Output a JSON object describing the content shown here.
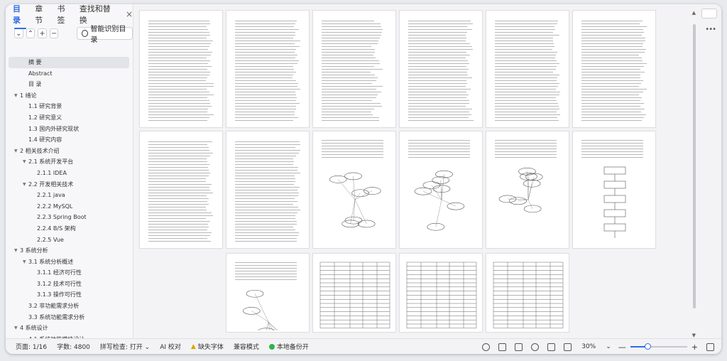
{
  "sidebar": {
    "tabs": [
      {
        "label": "目录",
        "active": true
      },
      {
        "label": "章节",
        "active": false
      },
      {
        "label": "书签",
        "active": false
      },
      {
        "label": "查找和替换",
        "active": false
      }
    ],
    "close_glyph": "×",
    "tools": {
      "collapse_glyph": "⌄",
      "expand_glyph": "⌃",
      "add_glyph": "+",
      "remove_glyph": "−",
      "ai_toc_label": "智能识别目录"
    },
    "toc": [
      {
        "label": "摘  要",
        "level": 1,
        "caret": "",
        "selected": true
      },
      {
        "label": "Abstract",
        "level": 1,
        "caret": ""
      },
      {
        "label": "目  录",
        "level": 1,
        "caret": ""
      },
      {
        "label": "1 绪论",
        "level": 1,
        "caret": "▼"
      },
      {
        "label": "1.1 研究背景",
        "level": 2,
        "caret": ""
      },
      {
        "label": "1.2 研究意义",
        "level": 2,
        "caret": ""
      },
      {
        "label": "1.3 国内外研究现状",
        "level": 2,
        "caret": ""
      },
      {
        "label": "1.4 研究内容",
        "level": 2,
        "caret": ""
      },
      {
        "label": "2 相关技术介绍",
        "level": 1,
        "caret": "▼"
      },
      {
        "label": "2.1 系统开发平台",
        "level": 2,
        "caret": "▼"
      },
      {
        "label": "2.1.1 IDEA",
        "level": 3,
        "caret": ""
      },
      {
        "label": "2.2 开发相关技术",
        "level": 2,
        "caret": "▼"
      },
      {
        "label": "2.2.1 java",
        "level": 3,
        "caret": ""
      },
      {
        "label": "2.2.2 MySQL",
        "level": 3,
        "caret": ""
      },
      {
        "label": "2.2.3 Spring Boot",
        "level": 3,
        "caret": ""
      },
      {
        "label": "2.2.4 B/S 架构",
        "level": 3,
        "caret": ""
      },
      {
        "label": "2.2.5 Vue",
        "level": 3,
        "caret": ""
      },
      {
        "label": "3 系统分析",
        "level": 1,
        "caret": "▼"
      },
      {
        "label": "3.1 系统分析概述",
        "level": 2,
        "caret": "▼"
      },
      {
        "label": "3.1.1 经济可行性",
        "level": 3,
        "caret": ""
      },
      {
        "label": "3.1.2 技术可行性",
        "level": 3,
        "caret": ""
      },
      {
        "label": "3.1.3 操作可行性",
        "level": 3,
        "caret": ""
      },
      {
        "label": "3.2 非功能需求分析",
        "level": 2,
        "caret": ""
      },
      {
        "label": "3.3 系统功能需求分析",
        "level": 2,
        "caret": ""
      },
      {
        "label": "4 系统设计",
        "level": 1,
        "caret": "▼"
      },
      {
        "label": "4.1 系统功能模块设计",
        "level": 2,
        "caret": ""
      }
    ]
  },
  "pages": {
    "rows": [
      [
        "text",
        "text",
        "toc",
        "text",
        "text",
        "text"
      ],
      [
        "text",
        "text",
        "diagram",
        "diagram",
        "diagram",
        "flow"
      ],
      [
        "empty",
        "diagram",
        "table",
        "table",
        "table",
        "empty"
      ]
    ]
  },
  "status": {
    "page": "页面: 1/16",
    "words": "字数: 4800",
    "spell": "拼写检查: 打开 ⌄",
    "ai_check": "AI 校对",
    "missing_font": "缺失字体",
    "compat": "兼容模式",
    "backup": "本地备份开",
    "zoom": "30%",
    "zoom_fraction": 0.3,
    "zoom_caret": "⌄",
    "minus": "—",
    "plus": "+"
  },
  "colors": {
    "accent": "#2f6be6",
    "warn": "#e0a100",
    "ok": "#2eb34f"
  }
}
